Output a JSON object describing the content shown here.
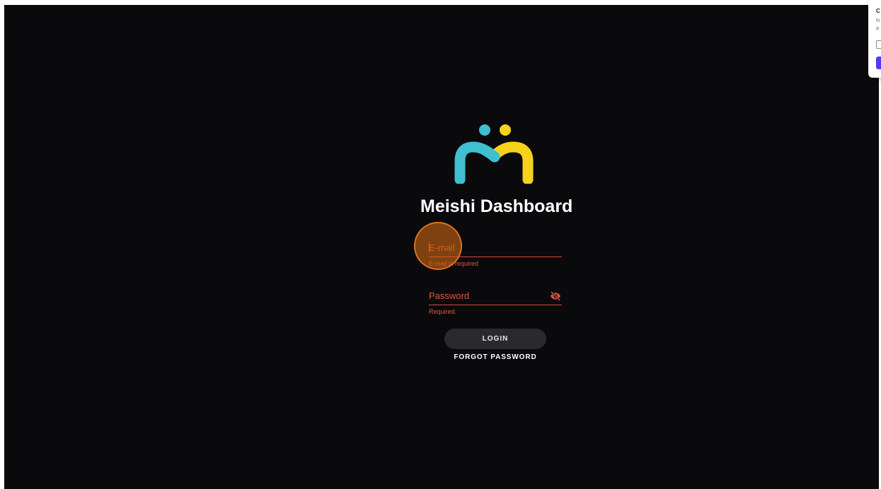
{
  "app": {
    "title": "Meishi Dashboard"
  },
  "logo": {
    "icon": "meishi-logo",
    "colors": {
      "left": "#3fbfd0",
      "right": "#f6d31a"
    }
  },
  "form": {
    "email": {
      "label": "E-mail",
      "error": "E-mail is required"
    },
    "password": {
      "label": "Password",
      "error": "Required.",
      "toggle_icon": "eye-off-icon"
    },
    "login_label": "LOGIN",
    "forgot_label": "FORGOT PASSWORD"
  },
  "colors": {
    "background": "#0a0a0d",
    "error": "#e5533e",
    "button": "#2a2a2e",
    "click_indicator": "#c86414"
  },
  "popup": {
    "title": "C",
    "line1": "N",
    "line2": "a"
  }
}
